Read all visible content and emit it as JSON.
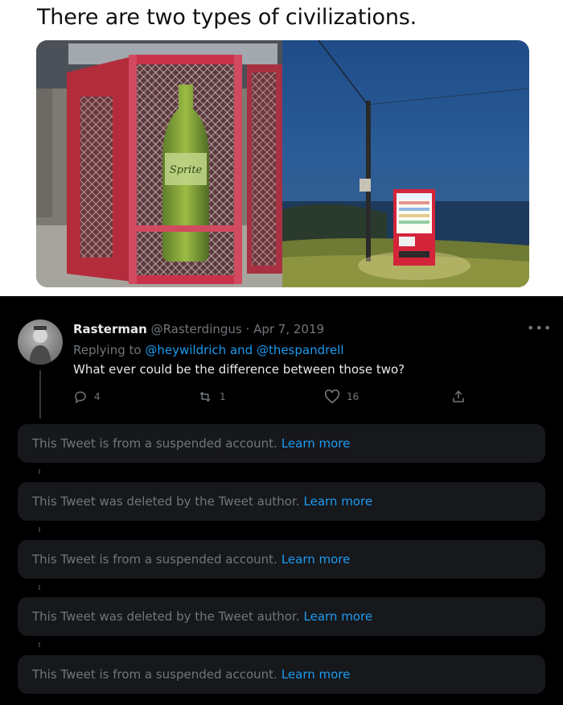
{
  "meme": {
    "caption": "There are two types of civilizations.",
    "left_photo": {
      "icon": "soda-cage-icon",
      "bottle_label": "Sprite"
    },
    "right_photo": {
      "icon": "vending-machine-icon"
    }
  },
  "tweet": {
    "display_name": "Rasterman",
    "handle": "@Rasterdingus",
    "separator": "·",
    "date": "Apr 7, 2019",
    "replying_prefix": "Replying to",
    "replying_users": "@heywildrich and @thespandrell",
    "text": "What ever could be the difference between those two?",
    "more_icon": "more-horizontal-icon",
    "actions": {
      "reply_count": "4",
      "retweet_count": "1",
      "like_count": "16"
    }
  },
  "notices": [
    {
      "text": "This Tweet is from a suspended account.",
      "link": "Learn more"
    },
    {
      "text": "This Tweet was deleted by the Tweet author.",
      "link": "Learn more"
    },
    {
      "text": "This Tweet is from a suspended account.",
      "link": "Learn more"
    },
    {
      "text": "This Tweet was deleted by the Tweet author.",
      "link": "Learn more"
    },
    {
      "text": "This Tweet is from a suspended account.",
      "link": "Learn more"
    }
  ],
  "colors": {
    "panel_bg": "#000000",
    "card_bg": "#16181c",
    "link": "#1d9bf0",
    "muted": "#71767b",
    "text": "#e7e9ea"
  }
}
